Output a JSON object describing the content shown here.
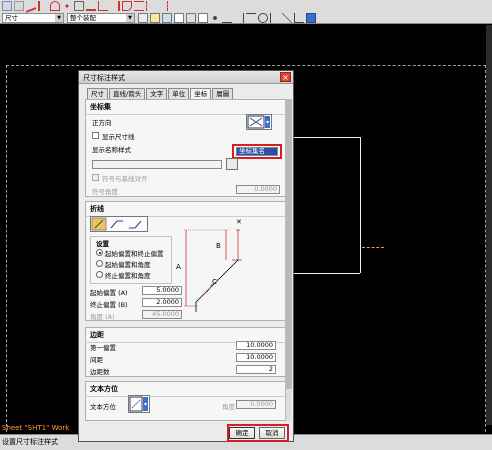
{
  "toolbar": {
    "layer_combo": "尺寸",
    "style_combo": "整个装配"
  },
  "canvas": {
    "sheet_label": "Sheet \"SHT1\" Work"
  },
  "status": {
    "text": "设置尺寸标注样式"
  },
  "dialog": {
    "title": "尺寸标注样式",
    "close": "×",
    "tabs": [
      {
        "label": "尺寸"
      },
      {
        "label": "直线/箭头"
      },
      {
        "label": "文字"
      },
      {
        "label": "单位"
      },
      {
        "label": "坐标"
      },
      {
        "label": "層圖"
      }
    ],
    "coord": {
      "section_title": "坐标集",
      "positive_direction_label": "正方向",
      "show_dim_line_label": "显示尺寸线",
      "display_name_style_label": "显示名称样式",
      "name_style_value": "坐标集名",
      "align_symbol_label": "符号与基线对齐",
      "symbol_angle_label": "符号角度",
      "symbol_angle_value": "0.0000"
    },
    "break": {
      "section_title": "折线",
      "settings_label": "设置",
      "options": [
        {
          "label": "起始偏置和终止偏置",
          "selected": true
        },
        {
          "label": "起始偏置和角度",
          "selected": false
        },
        {
          "label": "终止偏置和角度",
          "selected": false
        }
      ],
      "start_offset_label": "起始偏置 (A)",
      "start_offset_value": "5.0000",
      "end_offset_label": "终止偏置 (B)",
      "end_offset_value": "2.0000",
      "angle_label": "角度 (A)",
      "angle_value": "45.0000",
      "diagram_labels": {
        "a": "A",
        "b": "B",
        "c": "C"
      }
    },
    "margin": {
      "section_title": "边距",
      "first_offset_label": "第一偏置",
      "first_offset_value": "10.0000",
      "spacing_label": "间距",
      "spacing_value": "10.0000",
      "margin_count_label": "边距数",
      "margin_count_value": "2"
    },
    "text_orient": {
      "section_title": "文本方位",
      "orient_label": "文本方位",
      "angle_label": "角度",
      "angle_value": "0.0000"
    },
    "buttons": {
      "ok": "确定",
      "cancel": "取消"
    }
  }
}
